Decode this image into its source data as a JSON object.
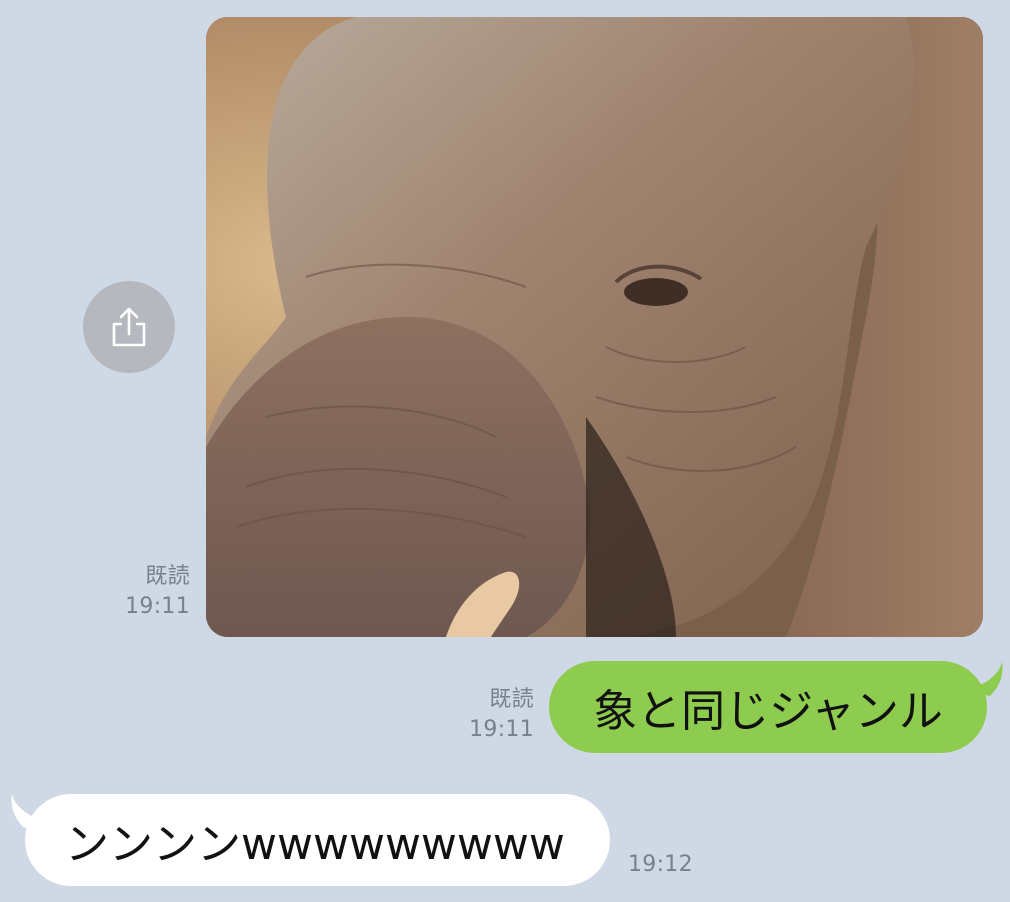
{
  "messages": [
    {
      "type": "image",
      "direction": "sent",
      "content": "elephant-photo",
      "read_label": "既読",
      "time": "19:11"
    },
    {
      "type": "text",
      "direction": "sent",
      "text": "象と同じジャンル",
      "read_label": "既読",
      "time": "19:11"
    },
    {
      "type": "text",
      "direction": "received",
      "text": "ンンンンwwwwwwwww",
      "time": "19:12"
    }
  ],
  "share_button": {
    "icon": "share-icon"
  },
  "colors": {
    "background": "#cfd8e5",
    "sent_bubble": "#8dcc4f",
    "received_bubble": "#ffffff",
    "meta_text": "#77808e",
    "share_button": "#b6b8bf"
  }
}
